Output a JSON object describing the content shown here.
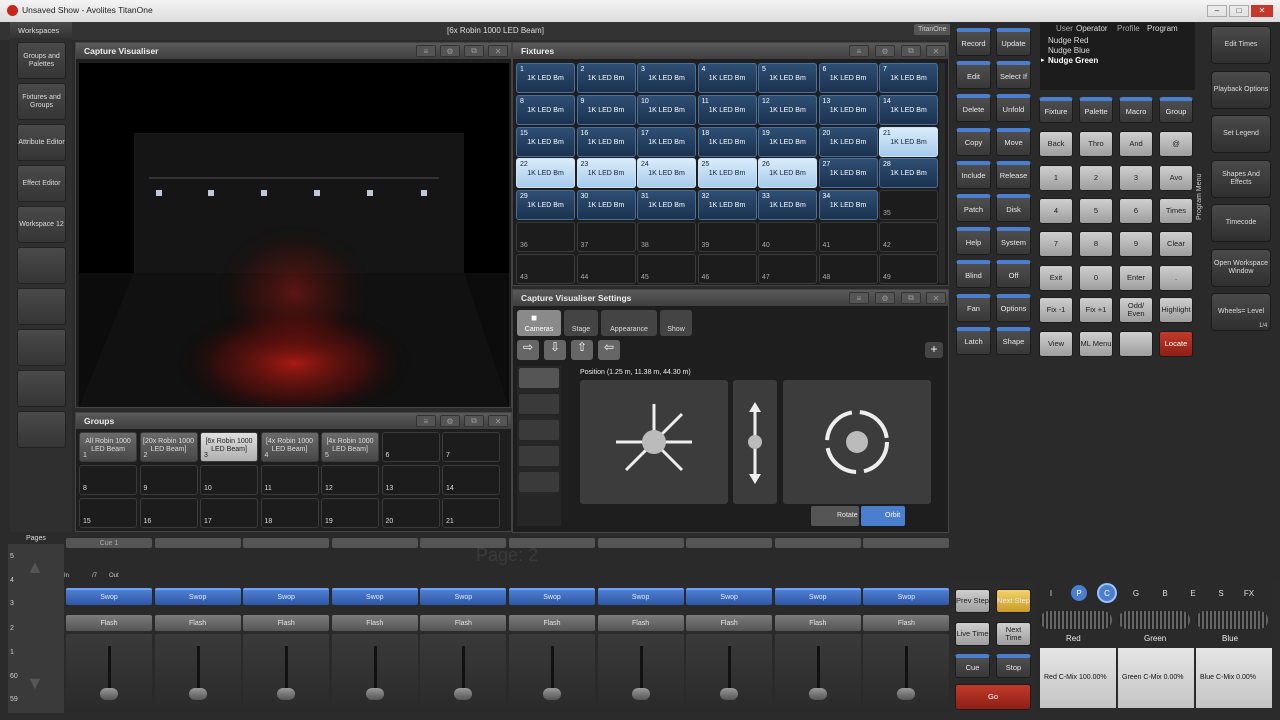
{
  "window": {
    "title": "Unsaved Show - Avolites TitanOne",
    "center_title": "[6x Robin 1000 LED Beam]",
    "brand_tag": "TitanOne"
  },
  "workspaces": {
    "header": "Workspaces",
    "items": [
      "Groups and Palettes",
      "Fixtures and Groups",
      "Attribute Editor",
      "Effect Editor",
      "Workspace 12",
      "",
      "",
      "",
      "",
      ""
    ]
  },
  "visualiser": {
    "title": "Capture Visualiser"
  },
  "fixtures": {
    "title": "Fixtures",
    "cells": [
      {
        "n": "1",
        "label": "1K LED Bm",
        "state": "fixture"
      },
      {
        "n": "2",
        "label": "1K LED Bm",
        "state": "fixture"
      },
      {
        "n": "3",
        "label": "1K LED Bm",
        "state": "fixture"
      },
      {
        "n": "4",
        "label": "1K LED Bm",
        "state": "fixture"
      },
      {
        "n": "5",
        "label": "1K LED Bm",
        "state": "fixture"
      },
      {
        "n": "6",
        "label": "1K LED Bm",
        "state": "fixture"
      },
      {
        "n": "7",
        "label": "1K LED Bm",
        "state": "fixture"
      },
      {
        "n": "8",
        "label": "1K LED Bm",
        "state": "fixture"
      },
      {
        "n": "9",
        "label": "1K LED Bm",
        "state": "fixture"
      },
      {
        "n": "10",
        "label": "1K LED Bm",
        "state": "fixture"
      },
      {
        "n": "11",
        "label": "1K LED Bm",
        "state": "fixture"
      },
      {
        "n": "12",
        "label": "1K LED Bm",
        "state": "fixture"
      },
      {
        "n": "13",
        "label": "1K LED Bm",
        "state": "fixture"
      },
      {
        "n": "14",
        "label": "1K LED Bm",
        "state": "fixture"
      },
      {
        "n": "15",
        "label": "1K LED Bm",
        "state": "fixture"
      },
      {
        "n": "16",
        "label": "1K LED Bm",
        "state": "fixture"
      },
      {
        "n": "17",
        "label": "1K LED Bm",
        "state": "fixture"
      },
      {
        "n": "18",
        "label": "1K LED Bm",
        "state": "fixture"
      },
      {
        "n": "19",
        "label": "1K LED Bm",
        "state": "fixture"
      },
      {
        "n": "20",
        "label": "1K LED Bm",
        "state": "fixture"
      },
      {
        "n": "21",
        "label": "1K LED Bm",
        "state": "selected"
      },
      {
        "n": "22",
        "label": "1K LED Bm",
        "state": "selected"
      },
      {
        "n": "23",
        "label": "1K LED Bm",
        "state": "selected"
      },
      {
        "n": "24",
        "label": "1K LED Bm",
        "state": "selected"
      },
      {
        "n": "25",
        "label": "1K LED Bm",
        "state": "selected"
      },
      {
        "n": "26",
        "label": "1K LED Bm",
        "state": "selected"
      },
      {
        "n": "27",
        "label": "1K LED Bm",
        "state": "fixture"
      },
      {
        "n": "28",
        "label": "1K LED Bm",
        "state": "fixture"
      },
      {
        "n": "29",
        "label": "1K LED Bm",
        "state": "fixture"
      },
      {
        "n": "30",
        "label": "1K LED Bm",
        "state": "fixture"
      },
      {
        "n": "31",
        "label": "1K LED Bm",
        "state": "fixture"
      },
      {
        "n": "32",
        "label": "1K LED Bm",
        "state": "fixture"
      },
      {
        "n": "33",
        "label": "1K LED Bm",
        "state": "fixture"
      },
      {
        "n": "34",
        "label": "1K LED Bm",
        "state": "fixture"
      },
      {
        "n": "35",
        "label": "",
        "state": "empty"
      },
      {
        "n": "36",
        "label": "",
        "state": "empty"
      },
      {
        "n": "37",
        "label": "",
        "state": "empty"
      },
      {
        "n": "38",
        "label": "",
        "state": "empty"
      },
      {
        "n": "39",
        "label": "",
        "state": "empty"
      },
      {
        "n": "40",
        "label": "",
        "state": "empty"
      },
      {
        "n": "41",
        "label": "",
        "state": "empty"
      },
      {
        "n": "42",
        "label": "",
        "state": "empty"
      },
      {
        "n": "43",
        "label": "",
        "state": "empty"
      },
      {
        "n": "44",
        "label": "",
        "state": "empty"
      },
      {
        "n": "45",
        "label": "",
        "state": "empty"
      },
      {
        "n": "46",
        "label": "",
        "state": "empty"
      },
      {
        "n": "47",
        "label": "",
        "state": "empty"
      },
      {
        "n": "48",
        "label": "",
        "state": "empty"
      },
      {
        "n": "49",
        "label": "",
        "state": "empty"
      }
    ]
  },
  "groups": {
    "title": "Groups",
    "cells": [
      {
        "n": "1",
        "label": "All Robin 1000 LED Beam",
        "state": "has"
      },
      {
        "n": "2",
        "label": "[20x Robin 1000 LED Beam]",
        "state": "has"
      },
      {
        "n": "3",
        "label": "[6x Robin 1000 LED Beam]",
        "state": "selected"
      },
      {
        "n": "4",
        "label": "[4x Robin 1000 LED Beam]",
        "state": "has"
      },
      {
        "n": "5",
        "label": "[4x Robin 1000 LED Beam]",
        "state": "has"
      },
      {
        "n": "6",
        "label": "",
        "state": "empty"
      },
      {
        "n": "7",
        "label": "",
        "state": "empty"
      },
      {
        "n": "8",
        "label": "",
        "state": "empty"
      },
      {
        "n": "9",
        "label": "",
        "state": "empty"
      },
      {
        "n": "10",
        "label": "",
        "state": "empty"
      },
      {
        "n": "11",
        "label": "",
        "state": "empty"
      },
      {
        "n": "12",
        "label": "",
        "state": "empty"
      },
      {
        "n": "13",
        "label": "",
        "state": "empty"
      },
      {
        "n": "14",
        "label": "",
        "state": "empty"
      },
      {
        "n": "15",
        "label": "",
        "state": "empty"
      },
      {
        "n": "16",
        "label": "",
        "state": "empty"
      },
      {
        "n": "17",
        "label": "",
        "state": "empty"
      },
      {
        "n": "18",
        "label": "",
        "state": "empty"
      },
      {
        "n": "19",
        "label": "",
        "state": "empty"
      },
      {
        "n": "20",
        "label": "",
        "state": "empty"
      },
      {
        "n": "21",
        "label": "",
        "state": "empty"
      }
    ]
  },
  "vis_settings": {
    "title": "Capture Visualiser Settings",
    "tabs": [
      "Cameras",
      "Stage",
      "Appearance",
      "Show"
    ],
    "position": "Position (1.25 m, 11.38 m, 44.30 m)",
    "rotate": "Rotate",
    "orbit": "Orbit"
  },
  "menu": {
    "user_label": "User",
    "operator_label": "Operator",
    "profile_label": "Profile",
    "program_label": "Program",
    "nudges": [
      "Nudge Red",
      "Nudge Blue",
      "Nudge Green"
    ],
    "program_menu": "Program Menu"
  },
  "keys": {
    "left_col": [
      "Record",
      "Edit",
      "Delete",
      "Copy",
      "Include",
      "Patch",
      "Help",
      "Blind",
      "Fan",
      "Latch"
    ],
    "right_col": [
      "Update",
      "Select If",
      "Unfold",
      "Move",
      "Release",
      "Disk",
      "System",
      "Off",
      "Options",
      "Shape"
    ],
    "row1": [
      "Fixture",
      "Palette",
      "Macro",
      "Group"
    ],
    "row2": [
      "Back",
      "Thro",
      "And",
      "@"
    ],
    "pad": [
      [
        "1",
        "2",
        "3",
        "Avo"
      ],
      [
        "4",
        "5",
        "6",
        "Times"
      ],
      [
        "7",
        "8",
        "9",
        "Clear"
      ],
      [
        "Exit",
        "0",
        "Enter",
        "."
      ]
    ],
    "row7": [
      "Fix -1",
      "Fix +1",
      "Odd/ Even",
      "Highlight"
    ],
    "row8": [
      "View",
      "ML Menu",
      "",
      "Locate"
    ]
  },
  "right_buttons": [
    "Edit Times",
    "Playback Options",
    "Set Legend",
    "Shapes And Effects",
    "Timecode",
    "Open Workspace Window",
    "Wheels= Level"
  ],
  "wheels_page": "1/4",
  "playback": {
    "pages_label": "Pages",
    "page_watermark": "Page: 2",
    "page_numbers": [
      "5",
      "4",
      "3",
      "2",
      "1",
      "60",
      "59"
    ],
    "cue_label": "Cue 1",
    "in_label": "In",
    "slash7": "/7",
    "out_label": "Out",
    "swop": "Swop",
    "flash": "Flash"
  },
  "transport": {
    "prev_step": "Prev Step",
    "next_step": "Next Step",
    "live_time": "Live Time",
    "next_time": "Next Time",
    "cue": "Cue",
    "stop": "Stop",
    "go": "Go"
  },
  "attributes": {
    "tabs": [
      "I",
      "P",
      "C",
      "G",
      "B",
      "E",
      "S",
      "FX"
    ],
    "wheels": [
      "Red",
      "Green",
      "Blue"
    ],
    "values": [
      "Red C-Mix 100.00%",
      "Green C-Mix 0.00%",
      "Blue C-Mix 0.00%"
    ]
  }
}
